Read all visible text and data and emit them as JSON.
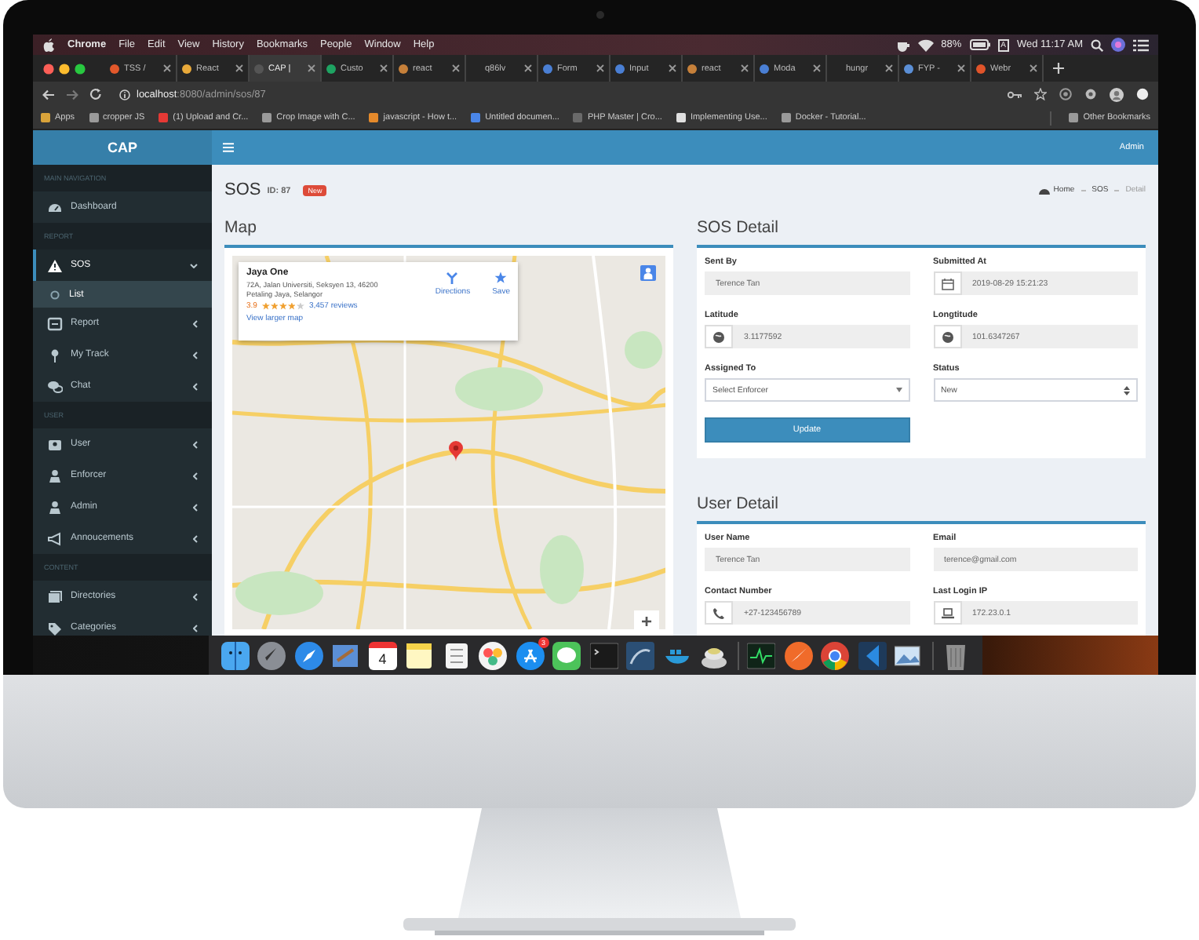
{
  "menu_bar": {
    "app": "Chrome",
    "menus": [
      "File",
      "Edit",
      "View",
      "History",
      "Bookmarks",
      "People",
      "Window",
      "Help"
    ],
    "battery": "88%",
    "input_source": "A",
    "clock": "Wed 11:17 AM"
  },
  "browser_tabs": [
    {
      "label": "TSS /",
      "color": "#e2582b",
      "selected": false
    },
    {
      "label": "React",
      "color": "#e8a93a",
      "selected": false
    },
    {
      "label": "CAP |",
      "color": "#555555",
      "selected": true
    },
    {
      "label": "Custo",
      "color": "#1ea362",
      "selected": false
    },
    {
      "label": "react",
      "color": "#c6803a",
      "selected": false
    },
    {
      "label": "q86lv",
      "selected": false
    },
    {
      "label": "Form",
      "color": "#4a7fd4",
      "selected": false
    },
    {
      "label": "Input",
      "color": "#4a7fd4",
      "selected": false
    },
    {
      "label": "react",
      "color": "#c6803a",
      "selected": false
    },
    {
      "label": "Moda",
      "color": "#4a7fd4",
      "selected": false
    },
    {
      "label": "hungr",
      "selected": false
    },
    {
      "label": "FYP -",
      "color": "#5b8fd6",
      "selected": false
    },
    {
      "label": "Webr",
      "color": "#e0542a",
      "selected": false
    }
  ],
  "address_bar": {
    "host": "localhost",
    "path": ":8080/admin/sos/87"
  },
  "bookmarks": [
    {
      "label": "Apps",
      "color": "#d9a33a"
    },
    {
      "label": "cropper JS",
      "color": "#9a9a9a"
    },
    {
      "label": "(1) Upload and Cr...",
      "color": "#e53935"
    },
    {
      "label": "Crop Image with C...",
      "color": "#9a9a9a"
    },
    {
      "label": "javascript - How t...",
      "color": "#e58a2b"
    },
    {
      "label": "Untitled documen...",
      "color": "#4a86e8"
    },
    {
      "label": "PHP Master | Cro...",
      "color": "#6a6a6a"
    },
    {
      "label": "Implementing Use...",
      "color": "#e0e0e0"
    },
    {
      "label": "Docker - Tutorial...",
      "color": "#9a9a9a"
    },
    {
      "label": "Other Bookmarks",
      "color": "#9a9a9a"
    }
  ],
  "app_header": {
    "logo": "CAP",
    "user": "Admin"
  },
  "sidebar": [
    {
      "kind": "header",
      "label": "MAIN NAVIGATION"
    },
    {
      "kind": "link",
      "label": "Dashboard",
      "selected": false
    },
    {
      "kind": "header",
      "label": "REPORT"
    },
    {
      "kind": "menu",
      "label": "SOS",
      "selected": true,
      "expanded": true,
      "children": [
        {
          "label": "List",
          "selected": true
        }
      ]
    },
    {
      "kind": "menu",
      "label": "Report",
      "selected": false,
      "expanded": false
    },
    {
      "kind": "menu",
      "label": "My Track",
      "selected": false,
      "expanded": false
    },
    {
      "kind": "menu",
      "label": "Chat",
      "selected": false,
      "expanded": false
    },
    {
      "kind": "header",
      "label": "USER"
    },
    {
      "kind": "menu",
      "label": "User",
      "selected": false,
      "expanded": false
    },
    {
      "kind": "menu",
      "label": "Enforcer",
      "selected": false,
      "expanded": false
    },
    {
      "kind": "menu",
      "label": "Admin",
      "selected": false,
      "expanded": false
    },
    {
      "kind": "menu",
      "label": "Annoucements",
      "selected": false,
      "expanded": false
    },
    {
      "kind": "header",
      "label": "CONTENT"
    },
    {
      "kind": "menu",
      "label": "Directories",
      "selected": false,
      "expanded": false
    },
    {
      "kind": "menu",
      "label": "Categories",
      "selected": false,
      "expanded": false
    }
  ],
  "page": {
    "title": "SOS",
    "id": "ID: 87",
    "badge": "New",
    "breadcrumb": [
      "Home",
      "SOS",
      "Detail"
    ]
  },
  "map_panel": {
    "title": "Map",
    "place": {
      "name": "Jaya One",
      "address": "72A, Jalan Universiti, Seksyen 13, 46200 Petaling Jaya, Selangor",
      "rating": "3.9",
      "stars": 4,
      "reviews": "3,457 reviews",
      "link": "View larger map",
      "actions": [
        "Directions",
        "Save"
      ]
    },
    "zoom_in": "+"
  },
  "sos_detail": {
    "title": "SOS Detail",
    "fields": [
      {
        "label": "Sent By",
        "value": "Terence Tan",
        "kind": "text"
      },
      {
        "label": "Submitted At",
        "value": "2019-08-29 15:21:23",
        "kind": "text"
      },
      {
        "label": "Latitude",
        "value": "3.1177592",
        "kind": "text"
      },
      {
        "label": "Longtitude",
        "value": "101.6347267",
        "kind": "text"
      },
      {
        "label": "Assigned To",
        "value": "Select Enforcer",
        "kind": "dropdown"
      },
      {
        "label": "Status",
        "value": "New",
        "kind": "select"
      }
    ],
    "button": "Update"
  },
  "user_detail": {
    "title": "User Detail",
    "fields": [
      {
        "label": "User Name",
        "value": "Terence Tan",
        "kind": "text"
      },
      {
        "label": "Email",
        "value": "terence@gmail.com",
        "kind": "text"
      },
      {
        "label": "Contact Number",
        "value": "+27-123456789",
        "kind": "text"
      },
      {
        "label": "Last Login IP",
        "value": "172.23.0.1",
        "kind": "text"
      }
    ]
  },
  "dock": {
    "calendar_day": "4",
    "app_store_badge": "3"
  }
}
